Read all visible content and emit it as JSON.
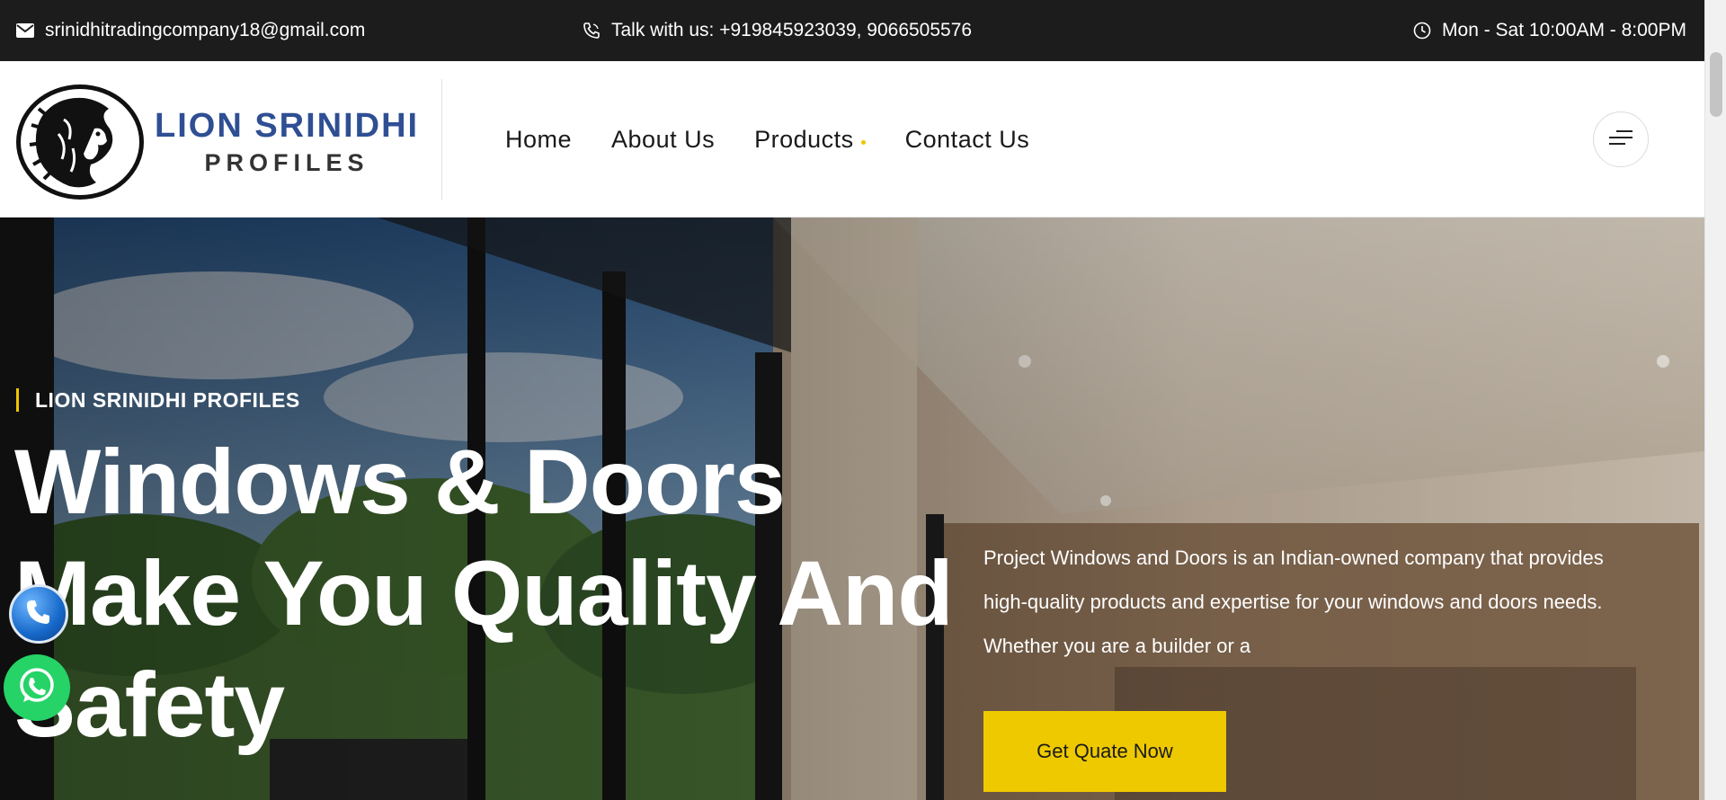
{
  "topbar": {
    "email": "srinidhitradingcompany18@gmail.com",
    "phone": "Talk with us: +919845923039, 9066505576",
    "hours": "Mon - Sat 10:00AM - 8:00PM",
    "icons": [
      "mail-icon",
      "phone-icon",
      "clock-icon"
    ]
  },
  "logo": {
    "line1": "LION SRINIDHI",
    "line2": "PROFILES"
  },
  "nav": {
    "items": [
      {
        "label": "Home"
      },
      {
        "label": "About Us"
      },
      {
        "label": "Products"
      },
      {
        "label": "Contact Us"
      }
    ]
  },
  "hero": {
    "tagline": "LION SRINIDHI PROFILES",
    "title_line1": "Windows & Doors",
    "title_line2": "Make You Quality And",
    "title_line3": "Safety",
    "description": "Project Windows and Doors is an Indian-owned company that provides high-quality products and expertise for your windows and doors needs. Whether you are a builder or a",
    "cta_label": "Get Quate Now"
  },
  "colors": {
    "topbar_bg": "#1c1c1c",
    "accent": "#eec900",
    "logo_blue": "#2f4f94",
    "whatsapp": "#25d366"
  }
}
